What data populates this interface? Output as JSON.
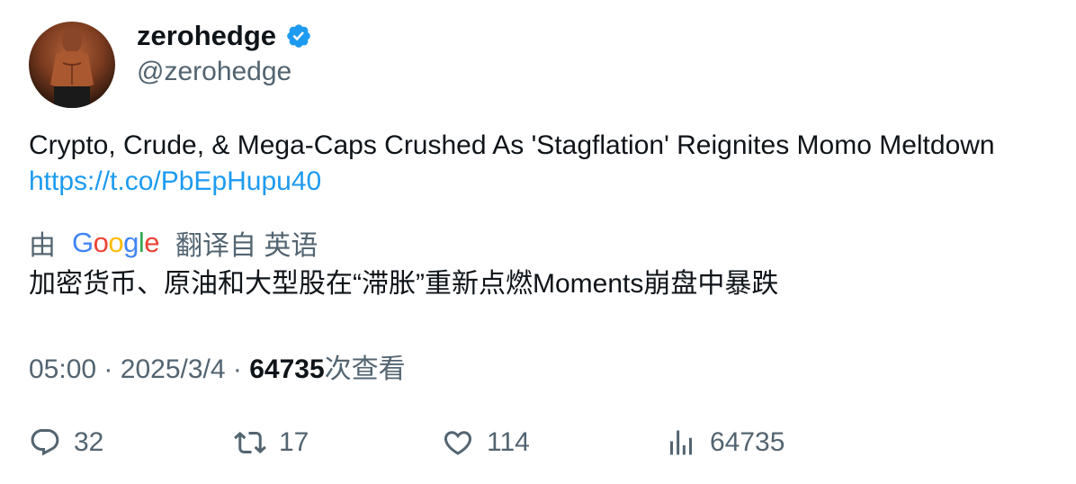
{
  "user": {
    "display_name": "zerohedge",
    "handle": "@zerohedge",
    "verified": true
  },
  "tweet": {
    "text": "Crypto, Crude, & Mega-Caps Crushed As 'Stagflation' Reignites Momo Meltdown ",
    "link": "https://t.co/PbEpHupu40"
  },
  "translation": {
    "prefix": "由",
    "provider": "Google",
    "suffix": "翻译自 英语",
    "text": "加密货币、原油和大型股在“滞胀”重新点燃Moments崩盘中暴跌"
  },
  "meta": {
    "time": "05:00",
    "separator": "·",
    "date": "2025/3/4",
    "views": "64735",
    "views_label": "次查看"
  },
  "actions": {
    "replies": "32",
    "retweets": "17",
    "likes": "114",
    "views": "64735"
  },
  "colors": {
    "link": "#1d9bf0",
    "verified": "#1d9bf0",
    "secondary_text": "#536471",
    "primary_text": "#0f1419"
  },
  "icons": [
    "verified-badge-icon",
    "reply-icon",
    "retweet-icon",
    "like-icon",
    "views-icon"
  ]
}
